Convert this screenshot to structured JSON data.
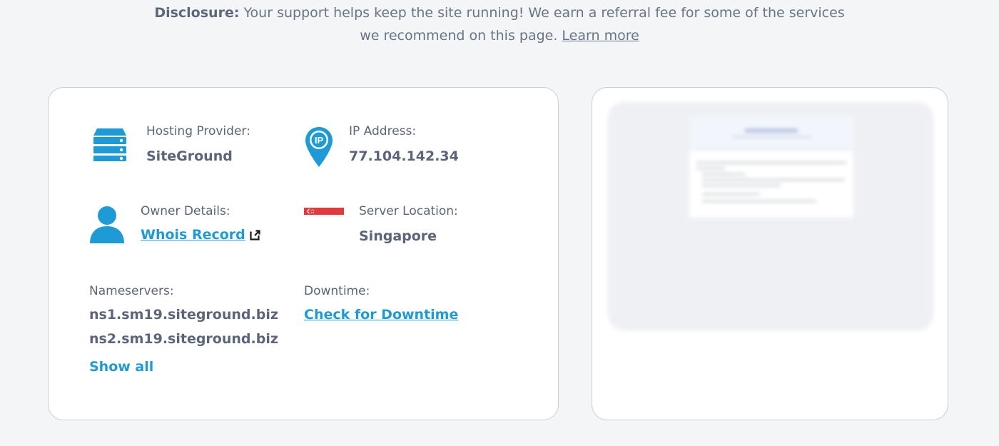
{
  "disclosure": {
    "label": "Disclosure:",
    "text_line1": " Your support helps keep the site running! We earn a referral fee for some of the services",
    "text_line2": "we recommend on this page. ",
    "link": "Learn more"
  },
  "hosting": {
    "label": "Hosting Provider:",
    "value": "SiteGround",
    "icon": "server-icon"
  },
  "ip": {
    "label": "IP Address:",
    "value": "77.104.142.34",
    "icon": "location-pin-icon",
    "icon_text": "IP"
  },
  "owner": {
    "label": "Owner Details:",
    "link": "Whois Record",
    "icon": "user-icon"
  },
  "location": {
    "label": "Server Location:",
    "value": "Singapore",
    "icon": "singapore-flag-icon"
  },
  "nameservers": {
    "label": "Nameservers:",
    "items": [
      "ns1.sm19.siteground.biz",
      "ns2.sm19.siteground.biz"
    ],
    "show_all": "Show all"
  },
  "downtime": {
    "label": "Downtime:",
    "link": "Check for Downtime"
  },
  "colors": {
    "accent": "#1e9bd7",
    "text": "#5b6579",
    "background": "#f4f5f7",
    "flag_red": "#e03a3e"
  }
}
